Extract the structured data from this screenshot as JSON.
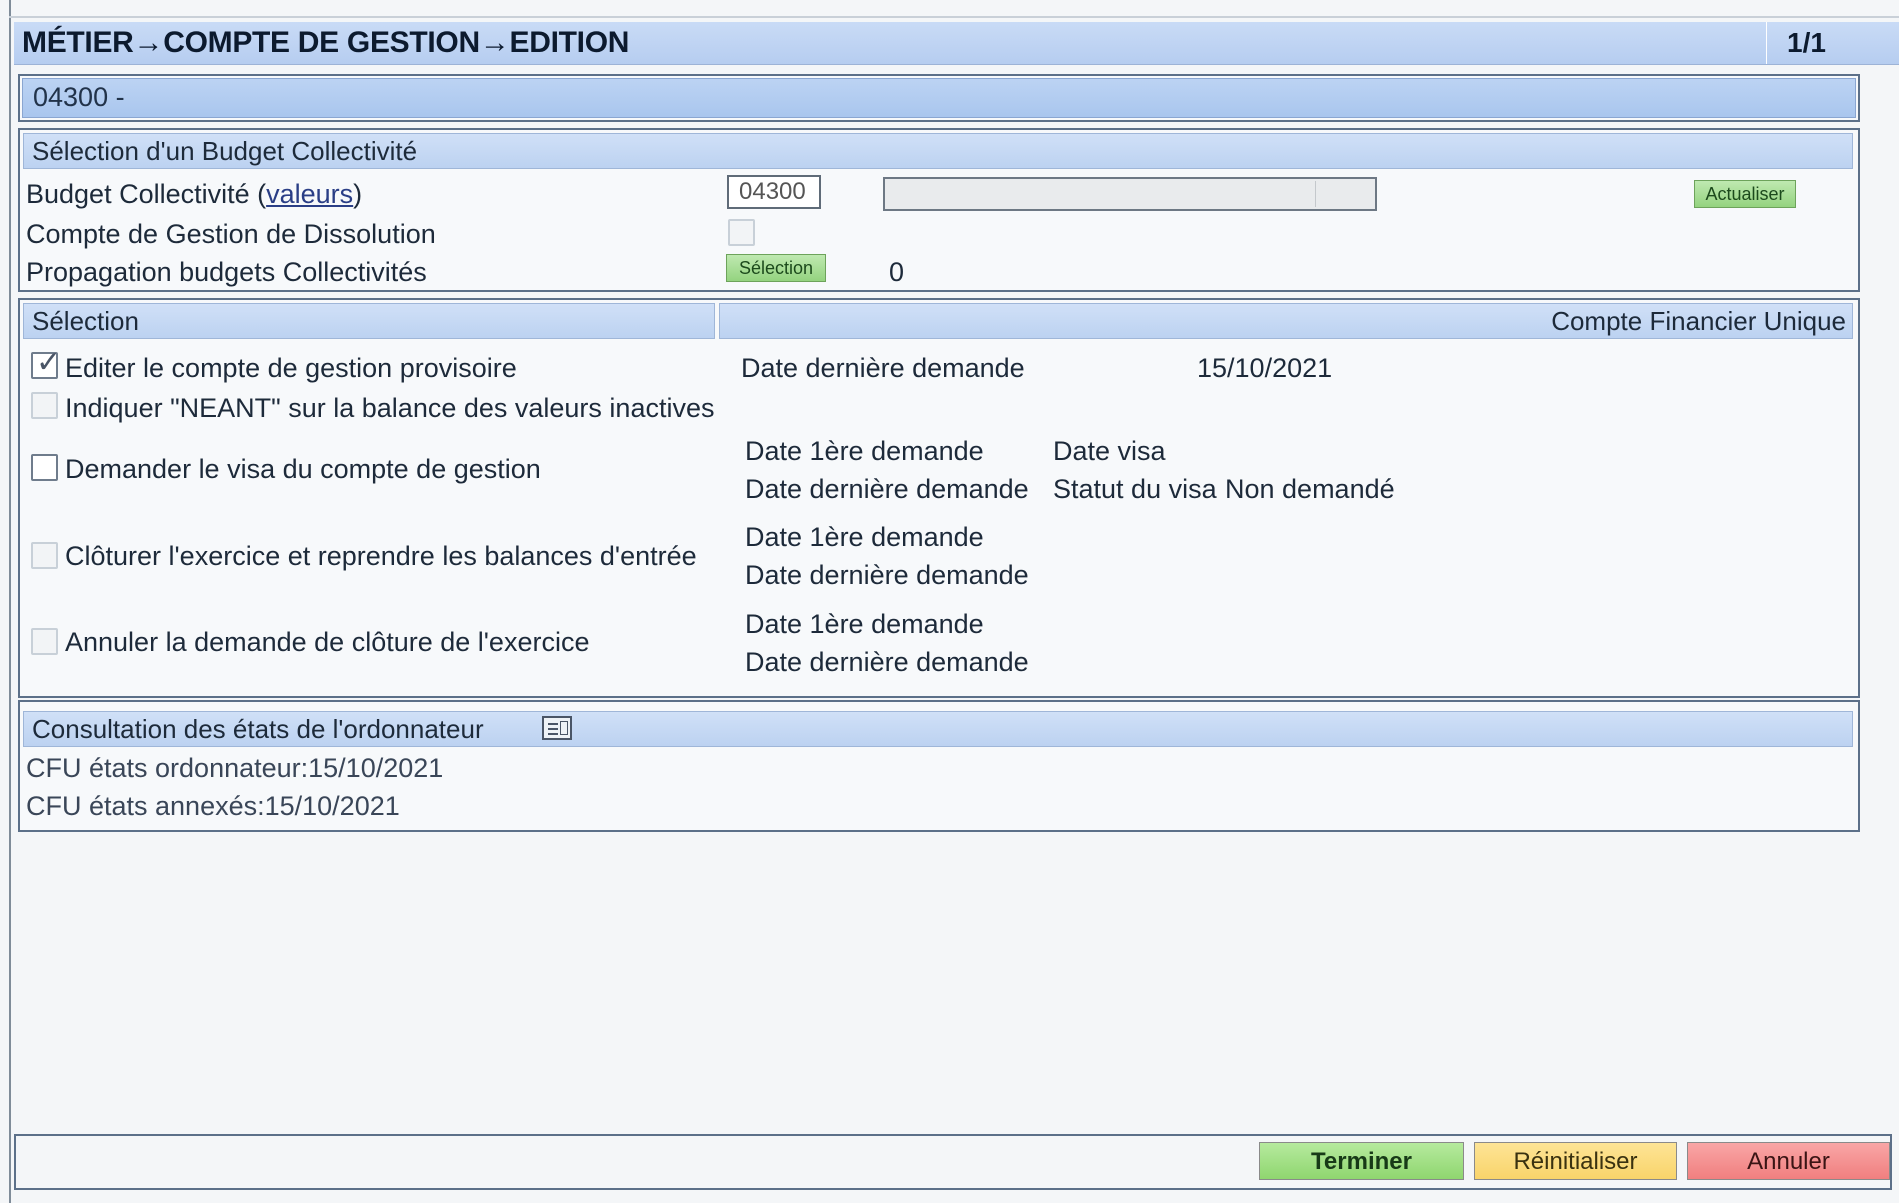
{
  "title_bar": {
    "title": "MÉTIER→COMPTE DE GESTION→EDITION",
    "page_count": "1/1"
  },
  "entity_bar": {
    "code": "04300 -"
  },
  "budget_section": {
    "header": "Sélection d'un Budget Collectivité",
    "budget_label_prefix": "Budget Collectivité (",
    "budget_link": "valeurs",
    "budget_label_suffix": ")",
    "budget_value": "04300",
    "refresh_button": "Actualiser",
    "dissolution_label": "Compte de Gestion de Dissolution",
    "dissolution_checked": false,
    "propagation_label": "Propagation budgets Collectivités",
    "selection_button": "Sélection",
    "propagation_count": "0"
  },
  "selection_section": {
    "header_left": "Sélection",
    "header_right": "Compte Financier Unique",
    "options": [
      {
        "label": "Editer le compte de gestion provisoire",
        "checked": true,
        "enabled": true
      },
      {
        "label": "Indiquer \"NEANT\" sur la balance des valeurs inactives",
        "checked": false,
        "enabled": false
      },
      {
        "label": "Demander le visa du compte de gestion",
        "checked": false,
        "enabled": true
      },
      {
        "label": "Clôturer l'exercice et reprendre les balances d'entrée",
        "checked": false,
        "enabled": false
      },
      {
        "label": "Annuler la demande de clôture de l'exercice",
        "checked": false,
        "enabled": false
      }
    ],
    "edit_last_request_label": "Date dernière demande",
    "edit_last_request_value": "15/10/2021",
    "visa_first_request_label": "Date 1ère demande",
    "visa_date_label": "Date visa",
    "visa_last_request_label": "Date dernière demande",
    "visa_status_label": "Statut du visa",
    "visa_status_value": "Non demandé",
    "close_first_request_label": "Date 1ère demande",
    "close_last_request_label": "Date dernière demande",
    "cancel_first_request_label": "Date 1ère demande",
    "cancel_last_request_label": "Date dernière demande"
  },
  "consultation_section": {
    "header": "Consultation des états de l'ordonnateur",
    "line1": "CFU états ordonnateur:15/10/2021",
    "line2": "CFU états annexés:15/10/2021"
  },
  "footer": {
    "finish_button": "Terminer",
    "reset_button": "Réinitialiser",
    "cancel_button": "Annuler"
  }
}
